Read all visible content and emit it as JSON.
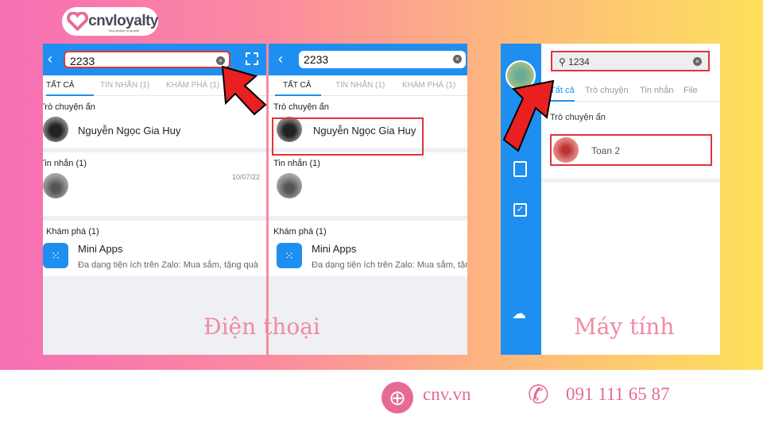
{
  "brand": {
    "name": "cnvloyalty",
    "tagline": "Your partner in growth"
  },
  "phone": {
    "search_value": "2233",
    "tabs": [
      "TẤT CẢ",
      "TIN NHẮN (1)",
      "KHÁM PHÁ (1)"
    ],
    "hidden_chats_title": "Trò chuyện ẩn",
    "contact_name": "Nguyễn Ngọc Gia Huy",
    "messages_title": "Tin nhắn (1)",
    "message_date": "10/07/22",
    "explore_title": "Khám phá (1)",
    "mini_apps_title": "Mini Apps",
    "mini_apps_desc": "Đa dạng tiện ích trên Zalo: Mua sắm, tặng quà"
  },
  "desktop": {
    "search_value": "1234",
    "tabs": [
      "Tất cả",
      "Trò chuyện",
      "Tin nhắn",
      "File"
    ],
    "hidden_chats_title": "Trò chuyện ẩn",
    "contact_name": "Toan 2"
  },
  "captions": {
    "phone": "Điện thoại",
    "desktop": "Máy tính"
  },
  "footer": {
    "website": "cnv.vn",
    "phone": "091 111 65 87"
  },
  "colors": {
    "accent": "#1e8ff0",
    "highlight": "#e0343a",
    "footer_text": "#e56b95"
  }
}
